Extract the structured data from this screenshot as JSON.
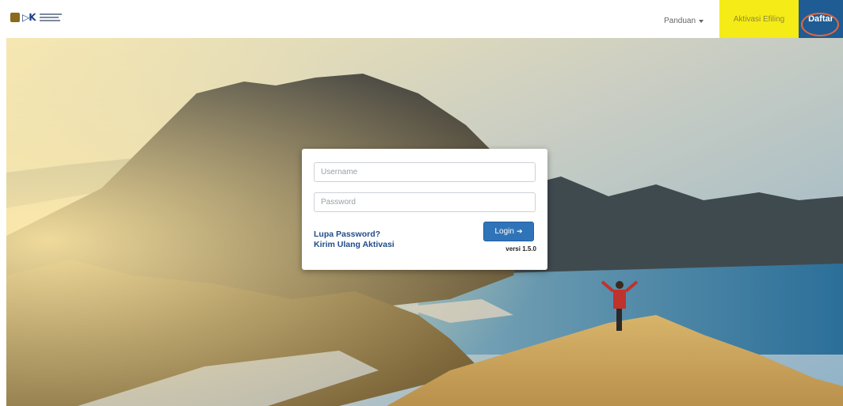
{
  "nav": {
    "guide_label": "Panduan",
    "efiling_label": "Aktivasi Efiling",
    "register_label": "Daftar"
  },
  "login": {
    "username_placeholder": "Username",
    "password_placeholder": "Password",
    "login_button": "Login",
    "login_icon": "sign-in-icon",
    "forgot_password": "Lupa Password?",
    "resend_activation": "Kirim Ulang Aktivasi",
    "version": "versi 1.5.0"
  },
  "colors": {
    "efiling_bg": "#f5eb17",
    "register_bg": "#1f5c94",
    "login_button_bg": "#2f74b8",
    "link_color": "#1f4c8a",
    "highlight_ring": "#e5663a"
  }
}
